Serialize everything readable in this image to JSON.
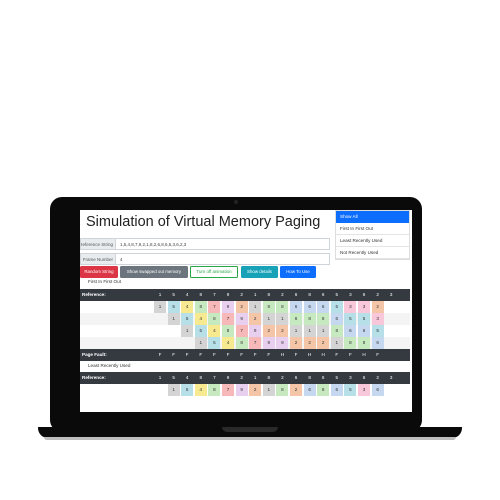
{
  "app": {
    "title": "Simulation of Virtual Memory Paging",
    "algorithms": [
      {
        "label": "Show All",
        "active": true
      },
      {
        "label": "First In First Out",
        "active": false
      },
      {
        "label": "Least Recently Used",
        "active": false
      },
      {
        "label": "Not Recently Used",
        "active": false
      }
    ],
    "form": {
      "reference_label": "Reference String",
      "reference_value": "1,5,4,8,7,9,2,1,8,2,6,8,6,5,3,6,2,3",
      "frame_label": "Frame Number",
      "frame_value": "4"
    },
    "buttons": {
      "random": "Random String",
      "swapped": "Show swapped out memory",
      "animation": "Turn off animation",
      "details": "Show details",
      "howto": "How To Use"
    }
  },
  "colors": {
    "c1": "#d4d4d4",
    "c2": "#b7dfe8",
    "c3": "#f6e98f",
    "c4": "#c7e9c0",
    "c5": "#f6b8b8",
    "c6": "#e8cff0",
    "c7": "#f4c6a7",
    "c8": "#c6d7f0",
    "c9": "#f8c8da",
    "c10": "#bfe3d0"
  },
  "sections": [
    {
      "heading": "First In First Out",
      "header_label": "Reference:",
      "refs": [
        "1",
        "5",
        "4",
        "8",
        "7",
        "9",
        "2",
        "1",
        "8",
        "2",
        "6",
        "8",
        "6",
        "5",
        "3",
        "6",
        "2",
        "3"
      ],
      "frames": [
        [
          "1",
          "5",
          "4",
          "8",
          "7",
          "9",
          "2",
          "1",
          "8",
          "8",
          "6",
          "6",
          "6",
          "5",
          "3",
          "3",
          "2",
          ""
        ],
        [
          "",
          "1",
          "5",
          "4",
          "8",
          "7",
          "9",
          "2",
          "1",
          "1",
          "8",
          "8",
          "8",
          "6",
          "5",
          "5",
          "3",
          ""
        ],
        [
          "",
          "",
          "1",
          "5",
          "4",
          "8",
          "7",
          "9",
          "2",
          "2",
          "1",
          "1",
          "1",
          "8",
          "6",
          "6",
          "5",
          ""
        ],
        [
          "",
          "",
          "",
          "1",
          "5",
          "4",
          "8",
          "7",
          "9",
          "9",
          "2",
          "2",
          "2",
          "1",
          "8",
          "8",
          "6",
          ""
        ]
      ],
      "result_label": "Page Fault:",
      "results": [
        "F",
        "F",
        "F",
        "F",
        "F",
        "F",
        "F",
        "F",
        "F",
        "H",
        "F",
        "H",
        "H",
        "F",
        "F",
        "H",
        "F",
        ""
      ]
    },
    {
      "heading": "Least Recently Used",
      "header_label": "Reference:",
      "refs": [
        "1",
        "5",
        "4",
        "8",
        "7",
        "9",
        "2",
        "1",
        "8",
        "2",
        "6",
        "8",
        "6",
        "5",
        "3",
        "6",
        "2",
        "3"
      ],
      "frames": [
        [
          "",
          "1",
          "5",
          "4",
          "8",
          "7",
          "9",
          "2",
          "1",
          "8",
          "2",
          "6",
          "8",
          "6",
          "5",
          "3",
          "6",
          ""
        ]
      ]
    }
  ]
}
